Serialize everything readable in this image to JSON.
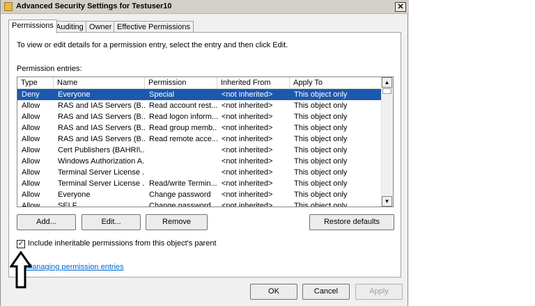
{
  "window": {
    "title": "Advanced Security Settings for Testuser10",
    "close_glyph": "✕"
  },
  "tabs": [
    {
      "label": "Permissions"
    },
    {
      "label": "Auditing"
    },
    {
      "label": "Owner"
    },
    {
      "label": "Effective Permissions"
    }
  ],
  "intro_text": "To view or edit details for a permission entry, select the entry and then click Edit.",
  "entries_label": "Permission entries:",
  "columns": [
    "Type",
    "Name",
    "Permission",
    "Inherited From",
    "Apply To"
  ],
  "rows": [
    {
      "type": "Deny",
      "name": "Everyone",
      "permission": "Special",
      "inherited": "<not inherited>",
      "apply": "This object only"
    },
    {
      "type": "Allow",
      "name": "RAS and IAS Servers (B...",
      "permission": "Read account rest...",
      "inherited": "<not inherited>",
      "apply": "This object only"
    },
    {
      "type": "Allow",
      "name": "RAS and IAS Servers (B...",
      "permission": "Read logon inform...",
      "inherited": "<not inherited>",
      "apply": "This object only"
    },
    {
      "type": "Allow",
      "name": "RAS and IAS Servers (B...",
      "permission": "Read group memb...",
      "inherited": "<not inherited>",
      "apply": "This object only"
    },
    {
      "type": "Allow",
      "name": "RAS and IAS Servers (B...",
      "permission": "Read remote acce...",
      "inherited": "<not inherited>",
      "apply": "This object only"
    },
    {
      "type": "Allow",
      "name": "Cert Publishers (BAHRI\\...",
      "permission": "",
      "inherited": "<not inherited>",
      "apply": "This object only"
    },
    {
      "type": "Allow",
      "name": "Windows Authorization A...",
      "permission": "",
      "inherited": "<not inherited>",
      "apply": "This object only"
    },
    {
      "type": "Allow",
      "name": "Terminal Server License ...",
      "permission": "",
      "inherited": "<not inherited>",
      "apply": "This object only"
    },
    {
      "type": "Allow",
      "name": "Terminal Server License ...",
      "permission": "Read/write Termin...",
      "inherited": "<not inherited>",
      "apply": "This object only"
    },
    {
      "type": "Allow",
      "name": "Everyone",
      "permission": "Change password",
      "inherited": "<not inherited>",
      "apply": "This object only"
    },
    {
      "type": "Allow",
      "name": "SELF",
      "permission": "Change password",
      "inherited": "<not inherited>",
      "apply": "This object only"
    }
  ],
  "selected_row": 0,
  "buttons": {
    "add": "Add...",
    "edit": "Edit...",
    "remove": "Remove",
    "restore": "Restore defaults",
    "ok": "OK",
    "cancel": "Cancel",
    "apply": "Apply"
  },
  "checkbox": {
    "label": "Include inheritable permissions from this object's parent",
    "checked": true,
    "mark": "✓"
  },
  "link_text": "Managing permission entries",
  "scroll": {
    "up": "▲",
    "down": "▼"
  }
}
